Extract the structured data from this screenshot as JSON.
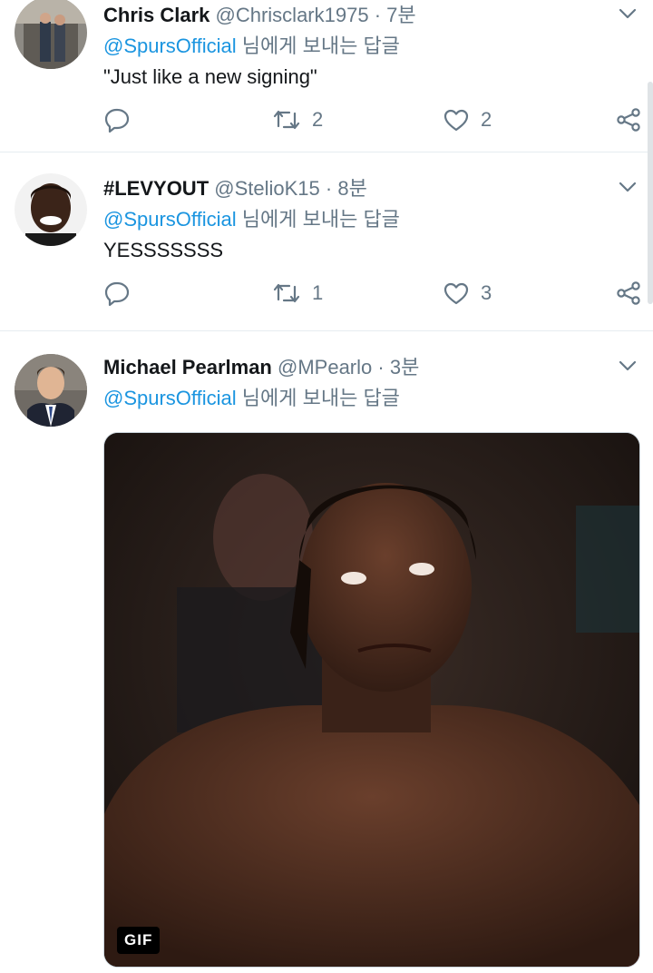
{
  "tweets": [
    {
      "name": "Chris Clark",
      "handle": "@Chrisclark1975",
      "time": "7분",
      "reply_mention": "@SpursOfficial",
      "reply_suffix": "님에게 보내는 답글",
      "text": "\"Just like a new signing\"",
      "retweets": "2",
      "likes": "2"
    },
    {
      "name": "#LEVYOUT",
      "handle": "@StelioK15",
      "time": "8분",
      "reply_mention": "@SpursOfficial",
      "reply_suffix": "님에게 보내는 답글",
      "text": "YESSSSSSS",
      "retweets": "1",
      "likes": "3"
    },
    {
      "name": "Michael Pearlman",
      "handle": "@MPearlo",
      "time": "3분",
      "reply_mention": "@SpursOfficial",
      "reply_suffix": "님에게 보내는 답글",
      "media_badge": "GIF"
    }
  ],
  "separator": "·",
  "colors": {
    "link": "#1b95e0",
    "secondary_text": "#657786",
    "primary_text": "#14171a",
    "divider": "#e6ecf0"
  },
  "icons": {
    "reply": "reply-icon",
    "retweet": "retweet-icon",
    "like": "heart-icon",
    "share": "share-icon",
    "more": "chevron-down-icon"
  }
}
